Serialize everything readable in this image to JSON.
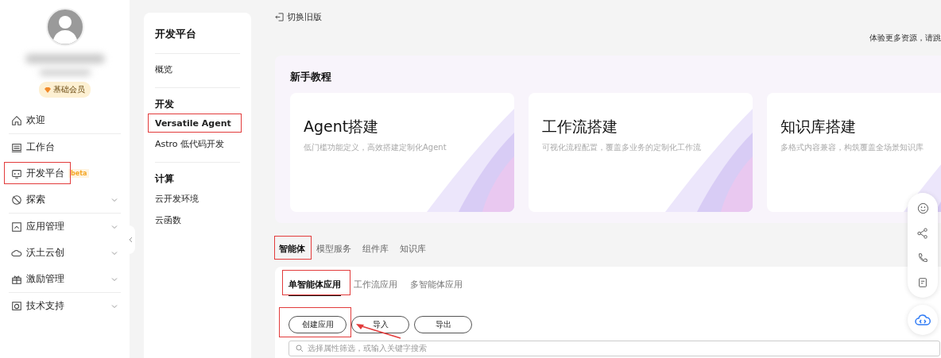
{
  "sidebar": {
    "badge": "基础会员",
    "groups": [
      [
        {
          "label": "欢迎",
          "expandable": false,
          "annotated": false
        }
      ],
      [
        {
          "label": "工作台",
          "expandable": false,
          "annotated": false
        },
        {
          "label": "开发平台",
          "tag": "beta",
          "expandable": false,
          "annotated": true
        },
        {
          "label": "探索",
          "expandable": true,
          "annotated": false
        }
      ],
      [
        {
          "label": "应用管理",
          "expandable": true,
          "annotated": false
        },
        {
          "label": "沃土云创",
          "expandable": true,
          "annotated": false
        },
        {
          "label": "激励管理",
          "expandable": true,
          "annotated": false
        }
      ],
      [
        {
          "label": "技术支持",
          "expandable": true,
          "annotated": false
        }
      ]
    ]
  },
  "subnav": {
    "title": "开发平台",
    "groups": [
      {
        "items": [
          {
            "label": "概览",
            "selected": false,
            "annotated": false
          }
        ]
      },
      {
        "heading": "开发",
        "items": [
          {
            "label": "Versatile Agent",
            "selected": true,
            "annotated": true
          },
          {
            "label": "Astro 低代码开发",
            "selected": false,
            "annotated": false
          }
        ]
      },
      {
        "heading": "计算",
        "items": [
          {
            "label": "云开发环境",
            "selected": false,
            "annotated": false
          },
          {
            "label": "云函数",
            "selected": false,
            "annotated": false
          }
        ]
      }
    ]
  },
  "header": {
    "back_link": "切换旧版",
    "notice": "体验更多资源，请跳"
  },
  "tutorials": {
    "title": "新手教程",
    "cards": [
      {
        "title": "Agent搭建",
        "desc": "低门槛功能定义，高效搭建定制化Agent"
      },
      {
        "title": "工作流搭建",
        "desc": "可视化流程配置，覆盖多业务的定制化工作流"
      },
      {
        "title": "知识库搭建",
        "desc": "多格式内容兼容，构筑覆盖全场景知识库"
      }
    ]
  },
  "tabs": [
    {
      "label": "智能体",
      "selected": true,
      "annotated": true
    },
    {
      "label": "模型服务",
      "selected": false,
      "annotated": false
    },
    {
      "label": "组件库",
      "selected": false,
      "annotated": false
    },
    {
      "label": "知识库",
      "selected": false,
      "annotated": false
    }
  ],
  "subtabs": [
    {
      "label": "单智能体应用",
      "selected": true,
      "annotated": true
    },
    {
      "label": "工作流应用",
      "selected": false,
      "annotated": false
    },
    {
      "label": "多智能体应用",
      "selected": false,
      "annotated": false
    }
  ],
  "buttons": [
    {
      "label": "创建应用",
      "annotated": true
    },
    {
      "label": "导入",
      "annotated": false
    },
    {
      "label": "导出",
      "annotated": false
    }
  ],
  "search": {
    "placeholder": "选择属性筛选，或输入关键字搜索"
  }
}
